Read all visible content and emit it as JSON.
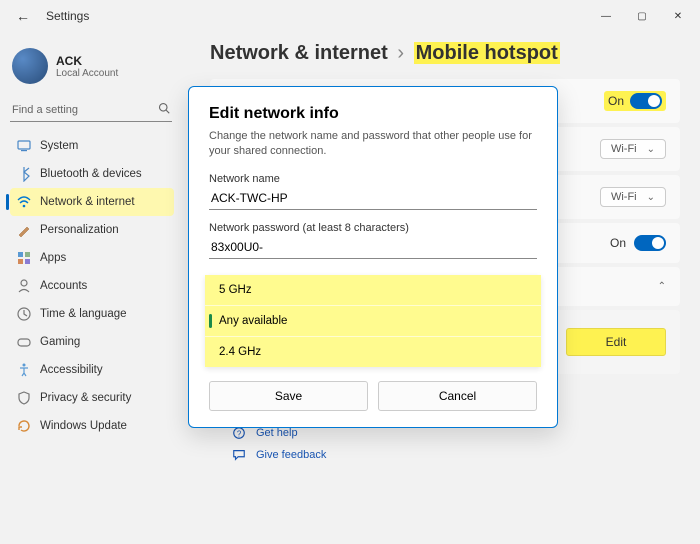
{
  "title": "Settings",
  "account": {
    "name": "ACK",
    "sub": "Local Account"
  },
  "search": {
    "placeholder": "Find a setting"
  },
  "sidebar": {
    "items": [
      {
        "label": "System",
        "icon": "system"
      },
      {
        "label": "Bluetooth & devices",
        "icon": "bluetooth"
      },
      {
        "label": "Network & internet",
        "icon": "wifi",
        "selected": true
      },
      {
        "label": "Personalization",
        "icon": "personalize"
      },
      {
        "label": "Apps",
        "icon": "apps"
      },
      {
        "label": "Accounts",
        "icon": "accounts"
      },
      {
        "label": "Time & language",
        "icon": "time"
      },
      {
        "label": "Gaming",
        "icon": "gaming"
      },
      {
        "label": "Accessibility",
        "icon": "accessibility"
      },
      {
        "label": "Privacy & security",
        "icon": "privacy"
      },
      {
        "label": "Windows Update",
        "icon": "update"
      }
    ]
  },
  "breadcrumb": {
    "root": "Network & internet",
    "leaf": "Mobile hotspot"
  },
  "rows": {
    "toggle1": {
      "state": "On"
    },
    "drop1": {
      "value": "Wi-Fi"
    },
    "drop2": {
      "value": "Wi-Fi"
    },
    "toggle2": {
      "state": "On"
    },
    "edit": {
      "label": "Edit"
    }
  },
  "modal": {
    "title": "Edit network info",
    "desc": "Change the network name and password that other people use for your shared connection.",
    "name_label": "Network name",
    "name_value": "ACK-TWC-HP",
    "pass_label": "Network password (at least 8 characters)",
    "pass_value": "83x00U0-",
    "options": [
      "5 GHz",
      "Any available",
      "2.4 GHz"
    ],
    "selected_option": "Any available",
    "save": "Save",
    "cancel": "Cancel"
  },
  "help": {
    "get": "Get help",
    "feedback": "Give feedback"
  }
}
